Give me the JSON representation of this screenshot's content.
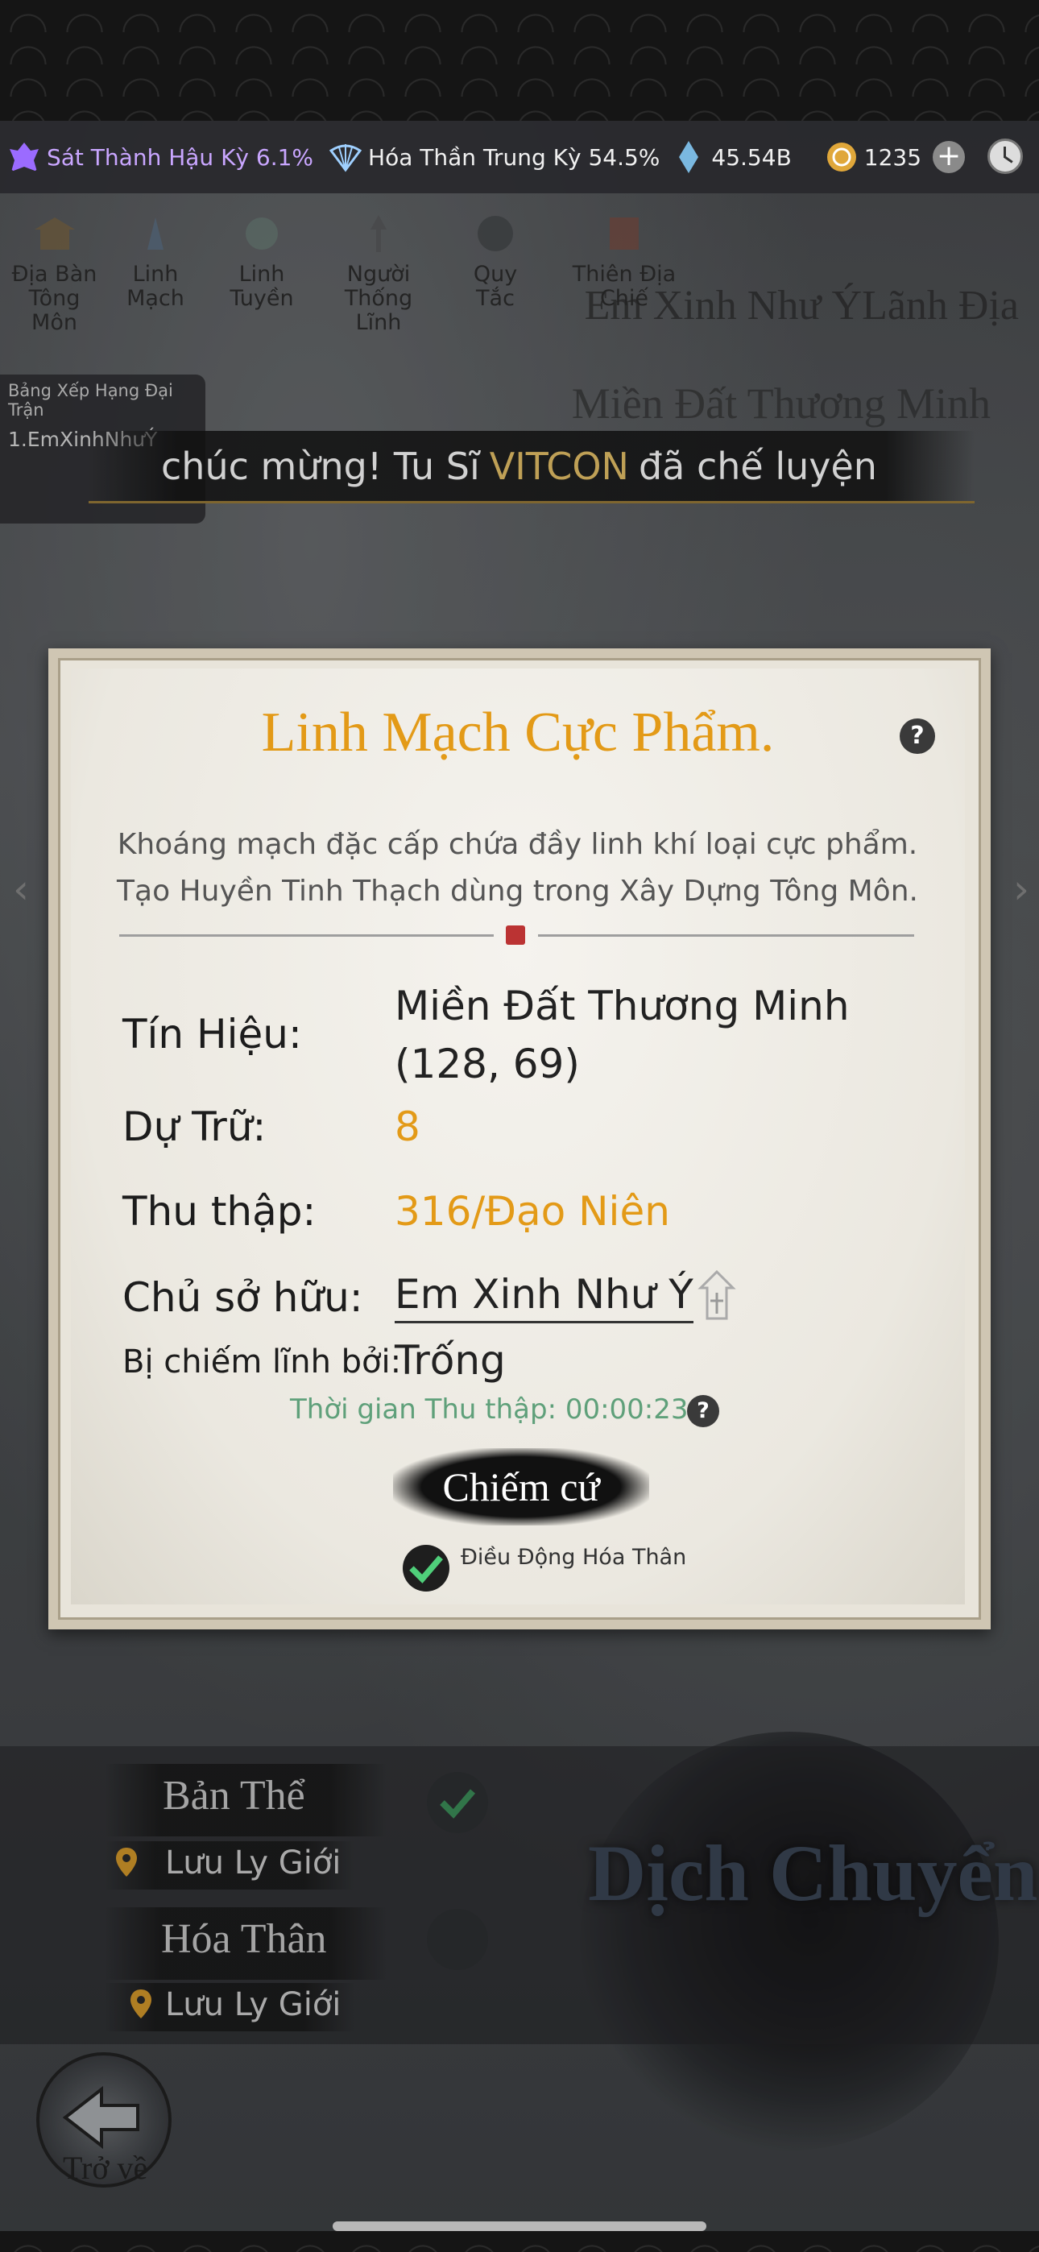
{
  "status": {
    "realm1": "Sát Thành Hậu Kỳ 6.1%",
    "realm2": "Hóa Thần Trung Kỳ 54.5%",
    "crystals": "45.54B",
    "coins": "1235",
    "plus": "+"
  },
  "nav": [
    {
      "label": "Địa Bàn Tông Môn",
      "icon": "territory-icon"
    },
    {
      "label": "Linh Mạch",
      "icon": "vein-icon"
    },
    {
      "label": "Linh Tuyền",
      "icon": "spring-icon"
    },
    {
      "label": "Người Thống Lĩnh",
      "icon": "leader-icon"
    },
    {
      "label": "Quy Tắc",
      "icon": "rules-icon"
    },
    {
      "label": "Thiên Địa Chiế",
      "icon": "battle-icon"
    }
  ],
  "map": {
    "territory_title": "Em Xinh Như ÝLãnh Địa",
    "region_title": "Miền Đất Thương Minh"
  },
  "ranking": {
    "title": "Bảng Xếp Hạng Đại Trận",
    "entry": "1.EmXinhNhưÝ"
  },
  "banner": {
    "prefix": "chúc mừng! Tu Sĩ",
    "name": "VITCON",
    "suffix": "đã chế luyện"
  },
  "dialog": {
    "title": "Linh Mạch Cực Phẩm.",
    "desc_line1": "Khoáng mạch đặc cấp chứa đầy linh khí loại cực phẩm.",
    "desc_line2": "Tạo Huyền Tinh Thạch dùng trong Xây Dựng Tông Môn.",
    "help": "?",
    "signal_label": "Tín Hiệu:",
    "signal_value": "Miền Đất Thương Minh",
    "signal_coords": "(128, 69)",
    "reserve_label": "Dự Trữ:",
    "reserve_value": "8",
    "collect_label": "Thu thập:",
    "collect_value": "316/Đạo Niên",
    "owner_label": "Chủ sở hữu:",
    "owner_value": "Em Xinh Như Ý",
    "occupied_label": "Bị chiếm lĩnh bởi:",
    "occupied_value": "Trống",
    "timer": "Thời gian Thu thập: 00:00:23",
    "action": "Chiếm cứ",
    "deploy_label": "Điều Động Hóa Thân",
    "deploy_checked": true
  },
  "lower": {
    "body_label": "Bản Thể",
    "body_location": "Lưu Ly Giới",
    "avatar_label": "Hóa Thân",
    "avatar_location": "Lưu Ly Giới",
    "teleport": "Dịch Chuyển",
    "back": "Trở về"
  }
}
